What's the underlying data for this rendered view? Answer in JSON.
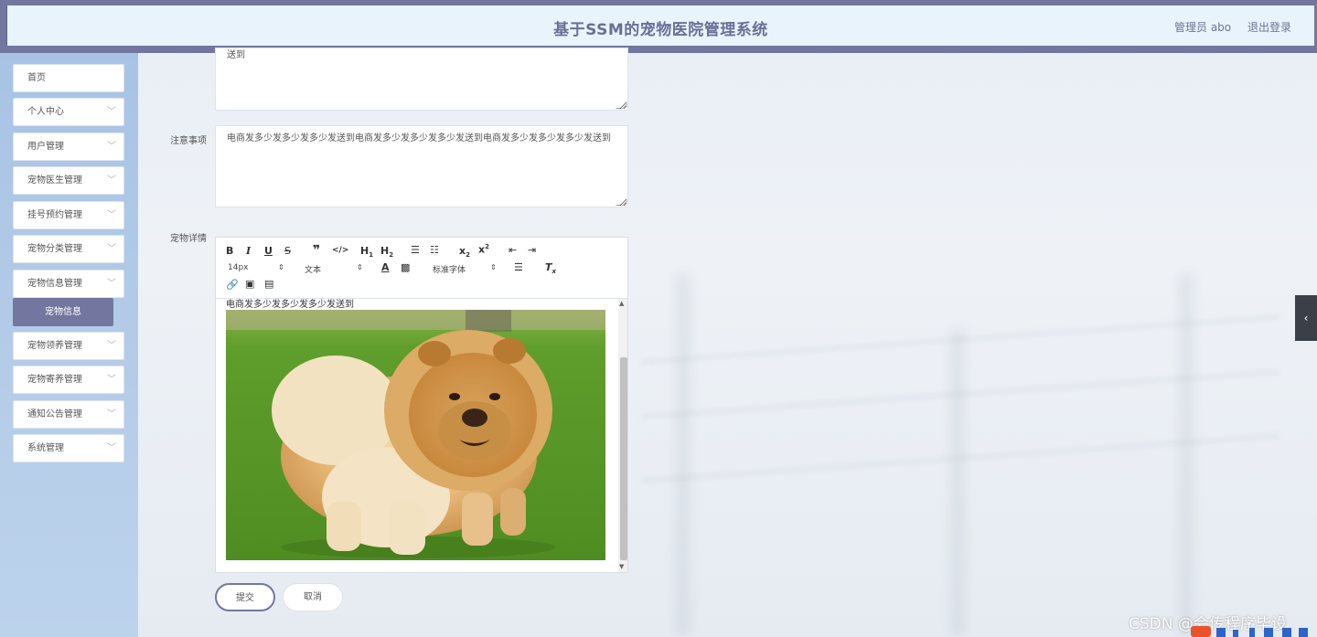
{
  "header": {
    "title": "基于SSM的宠物医院管理系统",
    "user": "管理员 abo",
    "logout": "退出登录"
  },
  "sidebar": {
    "items": [
      {
        "label": "首页",
        "has_arrow": false
      },
      {
        "label": "个人中心",
        "has_arrow": true
      },
      {
        "label": "用户管理",
        "has_arrow": true
      },
      {
        "label": "宠物医生管理",
        "has_arrow": true
      },
      {
        "label": "挂号预约管理",
        "has_arrow": true
      },
      {
        "label": "宠物分类管理",
        "has_arrow": true
      },
      {
        "label": "宠物信息管理",
        "has_arrow": true
      },
      {
        "label": "宠物领养管理",
        "has_arrow": true
      },
      {
        "label": "宠物寄养管理",
        "has_arrow": true
      },
      {
        "label": "通知公告管理",
        "has_arrow": true
      },
      {
        "label": "系统管理",
        "has_arrow": true
      }
    ],
    "active_submenu": "宠物信息"
  },
  "form": {
    "top_textarea_text": "送到",
    "notes_label": "注意事项",
    "notes_value": "电商发多少发多少发多少发送到电商发多少发多少发多少发送到电商发多少发多少发多少发送到",
    "details_label": "宠物详情",
    "editor": {
      "toolbar": {
        "font_size": "14px",
        "block_type": "文本",
        "font_family": "标准字体"
      },
      "content_text": "电商发多少发多少发多少发送到"
    },
    "submit_label": "提交",
    "cancel_label": "取消"
  },
  "watermark": "CSDN @会传程序毕设",
  "colors": {
    "header_bar": "#7377a0",
    "header_inner": "#e8f3fc",
    "sidebar": "#b0c8e7",
    "active_submenu": "#7377a0"
  }
}
